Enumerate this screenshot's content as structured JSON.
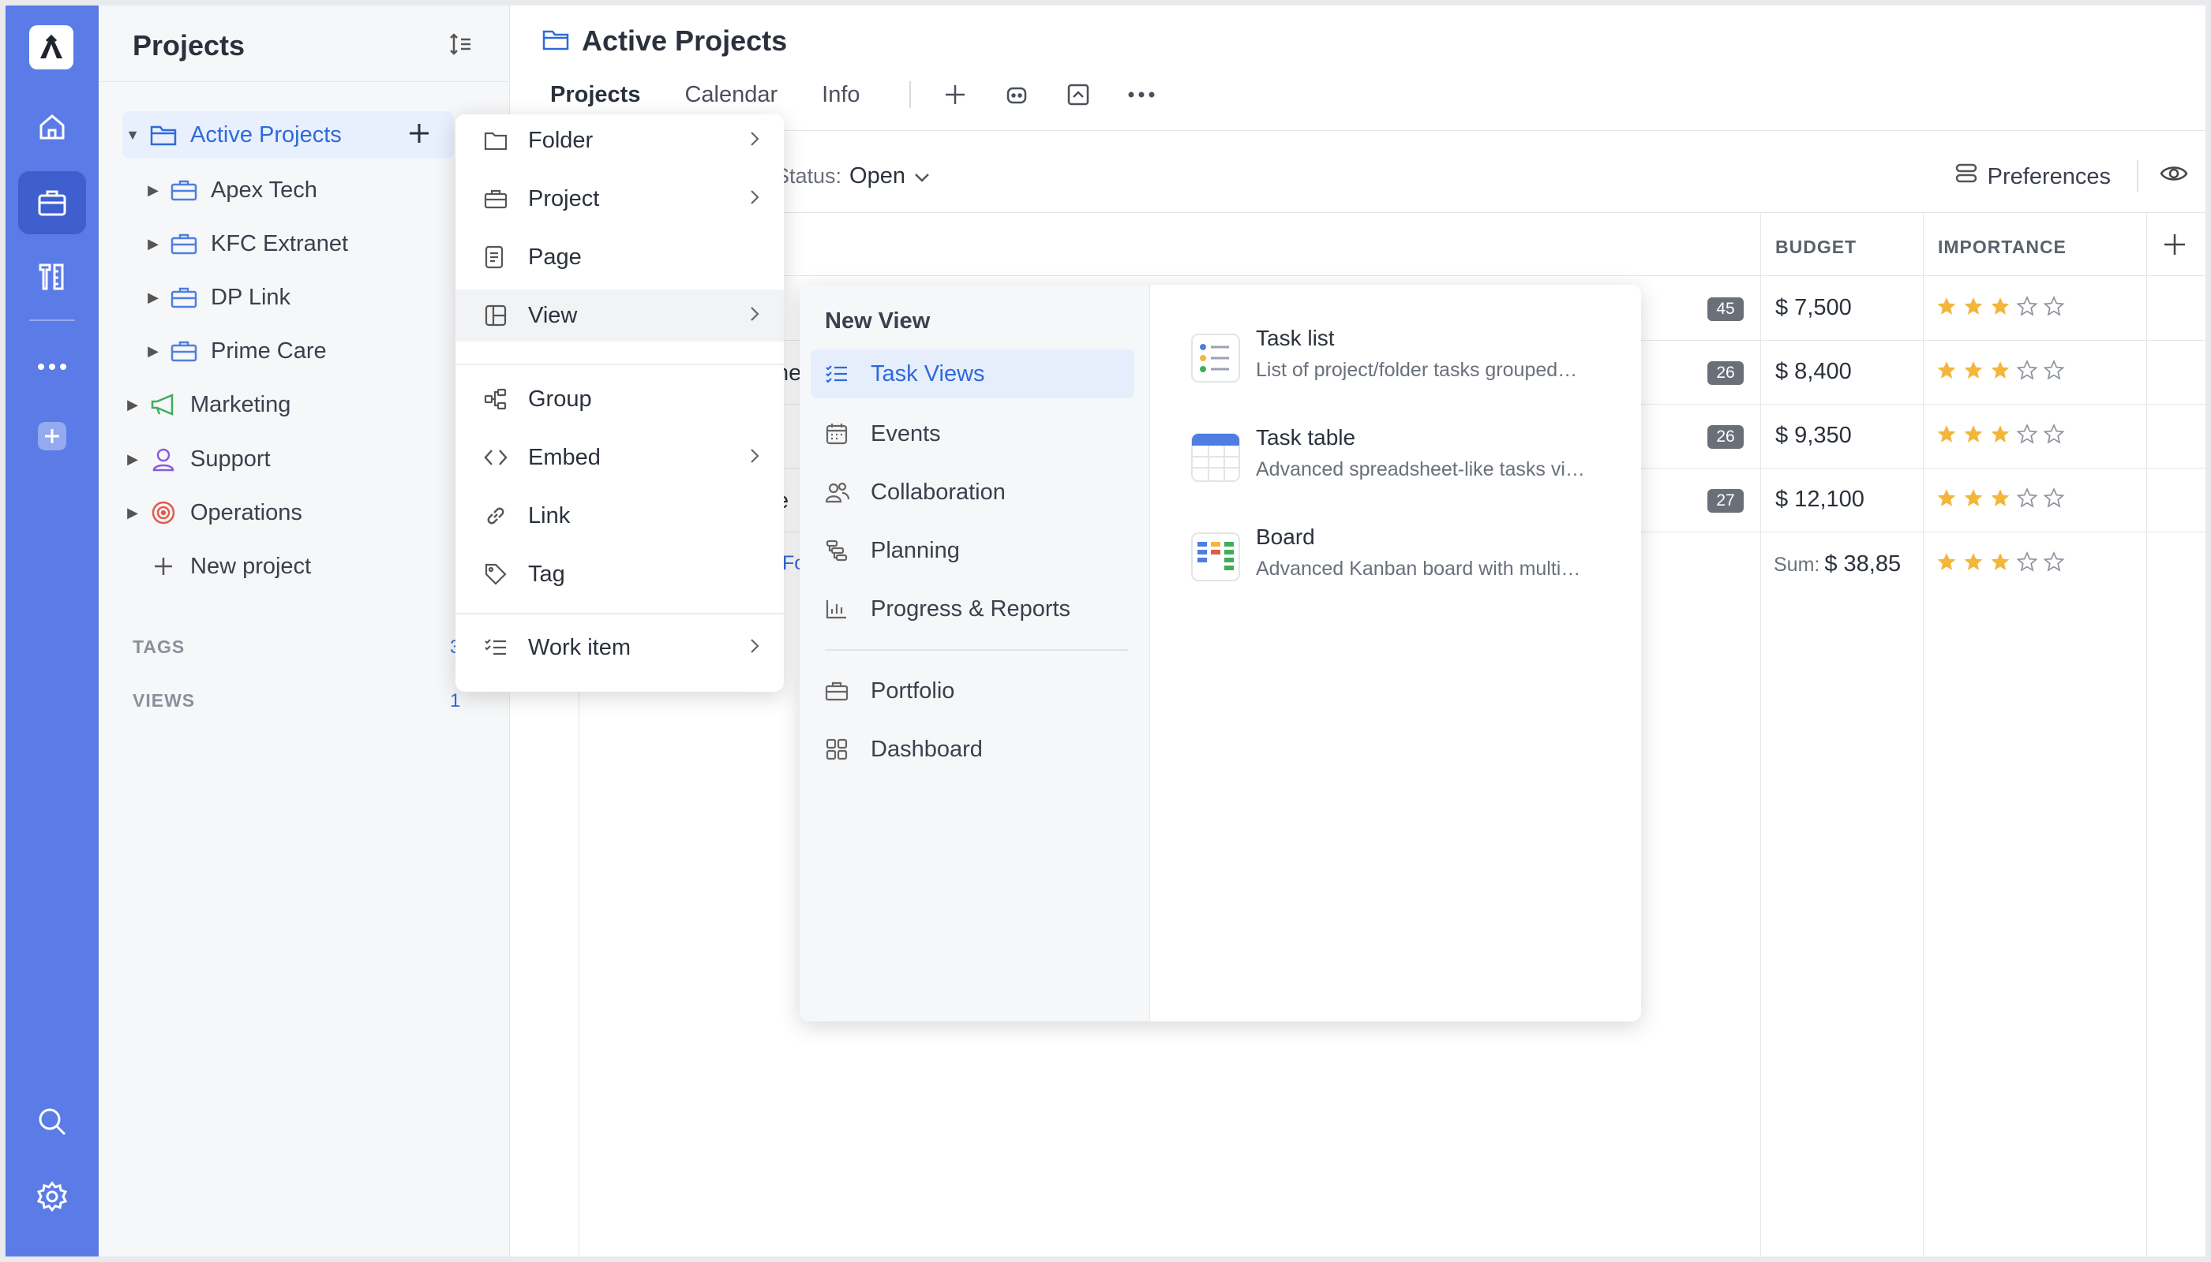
{
  "rail": {
    "icons": [
      "logo-icon",
      "home-icon",
      "briefcase-icon",
      "tools-icon",
      "more-icon",
      "add-icon",
      "search-icon",
      "settings-icon"
    ]
  },
  "sidebar": {
    "title": "Projects",
    "items": [
      {
        "label": "Active Projects",
        "icon": "folder-icon"
      },
      {
        "label": "Apex Tech",
        "icon": "briefcase-icon"
      },
      {
        "label": "KFC Extranet",
        "icon": "briefcase-icon"
      },
      {
        "label": "DP Link",
        "icon": "briefcase-icon"
      },
      {
        "label": "Prime Care",
        "icon": "briefcase-icon"
      },
      {
        "label": "Marketing",
        "icon": "megaphone-icon"
      },
      {
        "label": "Support",
        "icon": "support-icon"
      },
      {
        "label": "Operations",
        "icon": "target-icon"
      }
    ],
    "new_project": "New project",
    "tags_label": "TAGS",
    "tags_count": "3",
    "views_label": "VIEWS",
    "views_count": "1"
  },
  "main": {
    "title": "Active Projects",
    "tabs": [
      {
        "label": "Projects"
      },
      {
        "label": "Calendar"
      },
      {
        "label": "Info"
      }
    ],
    "filter_label": "Status:",
    "filter_value": "Open",
    "preferences": "Preferences",
    "columns": {
      "budget": "BUDGET",
      "importance": "IMPORTANCE"
    },
    "partials": {
      "r2": "ne",
      "r4": "e",
      "r5": "Fo"
    },
    "rows": [
      {
        "count": "45",
        "budget": "$ 7,500",
        "stars": 3
      },
      {
        "count": "26",
        "budget": "$ 8,400",
        "stars": 3
      },
      {
        "count": "26",
        "budget": "$ 9,350",
        "stars": 3
      },
      {
        "count": "27",
        "budget": "$ 12,100",
        "stars": 3
      }
    ],
    "sum_label": "Sum:",
    "sum_value": "$ 38,85",
    "sum_stars": 3,
    "star_color": "#f2b63c"
  },
  "menu": {
    "items": [
      {
        "label": "Folder",
        "icon": "folder-icon"
      },
      {
        "label": "Project",
        "icon": "briefcase-icon"
      },
      {
        "label": "Page",
        "icon": "page-icon"
      },
      {
        "label": "View",
        "icon": "view-icon"
      },
      {
        "label": "Group",
        "icon": "group-icon"
      },
      {
        "label": "Embed",
        "icon": "embed-icon"
      },
      {
        "label": "Link",
        "icon": "link-icon"
      },
      {
        "label": "Tag",
        "icon": "tag-icon"
      },
      {
        "label": "Work item",
        "icon": "work-item-icon"
      }
    ]
  },
  "submenu": {
    "header": "New View",
    "categories": [
      {
        "label": "Task Views",
        "icon": "task-views-icon"
      },
      {
        "label": "Events",
        "icon": "calendar-icon"
      },
      {
        "label": "Collaboration",
        "icon": "people-icon"
      },
      {
        "label": "Planning",
        "icon": "planning-icon"
      },
      {
        "label": "Progress & Reports",
        "icon": "chart-icon"
      },
      {
        "label": "Portfolio",
        "icon": "briefcase-icon"
      },
      {
        "label": "Dashboard",
        "icon": "dashboard-icon"
      }
    ],
    "views": [
      {
        "title": "Task list",
        "desc": "List of project/folder tasks grouped…"
      },
      {
        "title": "Task table",
        "desc": "Advanced spreadsheet-like tasks vi…"
      },
      {
        "title": "Board",
        "desc": "Advanced Kanban board with multi…"
      }
    ]
  }
}
